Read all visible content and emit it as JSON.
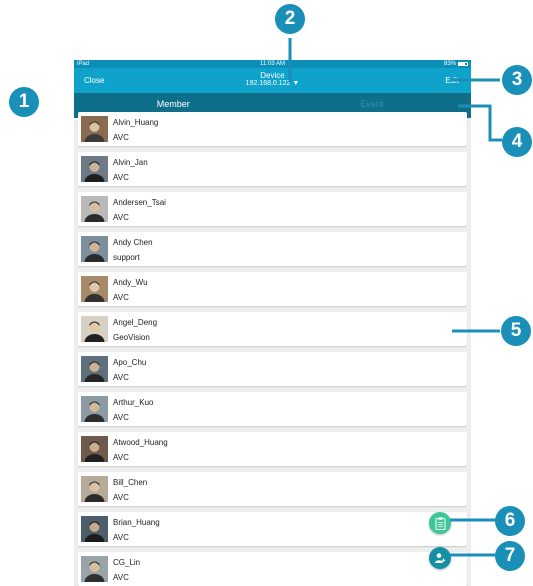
{
  "status_bar": {
    "left": "iPad",
    "time": "11:03 AM",
    "battery": "83%"
  },
  "nav": {
    "close_label": "Close",
    "title": "Device",
    "ip": "192.168.0.122",
    "edit_label": "Edit"
  },
  "tabs": [
    {
      "label": "Member",
      "active": true
    },
    {
      "label": "Event",
      "active": false
    }
  ],
  "members": [
    {
      "name": "Alvin_Huang",
      "org": "AVC"
    },
    {
      "name": "Alvin_Jan",
      "org": "AVC"
    },
    {
      "name": "Andersen_Tsai",
      "org": "AVC"
    },
    {
      "name": "Andy Chen",
      "org": "support"
    },
    {
      "name": "Andy_Wu",
      "org": "AVC"
    },
    {
      "name": "Angel_Deng",
      "org": "GeoVision"
    },
    {
      "name": "Apo_Chu",
      "org": "AVC"
    },
    {
      "name": "Arthur_Kuo",
      "org": "AVC"
    },
    {
      "name": "Atwood_Huang",
      "org": "AVC"
    },
    {
      "name": "Bill_Chen",
      "org": "AVC"
    },
    {
      "name": "Brian_Huang",
      "org": "AVC"
    },
    {
      "name": "CG_Lin",
      "org": "AVC"
    }
  ],
  "callouts": [
    "1",
    "2",
    "3",
    "4",
    "5",
    "6",
    "7"
  ],
  "colors": {
    "navbar": "#0fa3cc",
    "tabbar": "#0f6f8a",
    "callout": "#1a8fb8",
    "fab_event": "#3cc799",
    "fab_add": "#148fa4"
  }
}
